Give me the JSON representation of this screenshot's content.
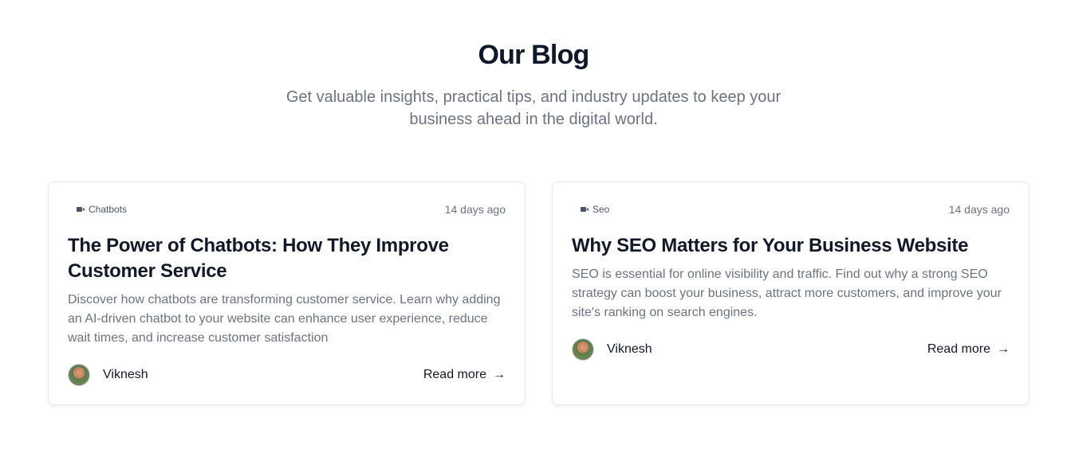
{
  "section": {
    "heading": "Our Blog",
    "subtitle": "Get valuable insights, practical tips, and industry updates to keep your business ahead in the digital world."
  },
  "posts": [
    {
      "category": "Chatbots",
      "category_icon": "video-icon",
      "date": "14 days ago",
      "title": "The Power of Chatbots: How They Improve Customer Service",
      "description": "Discover how chatbots are transforming customer service. Learn why adding an AI-driven chatbot to your website can enhance user experience, reduce wait times, and increase customer satisfaction",
      "author": "Viknesh",
      "read_more": "Read more",
      "read_more_icon": "arrow-right-icon"
    },
    {
      "category": "Seo",
      "category_icon": "video-icon",
      "date": "14 days ago",
      "title": "Why SEO Matters for Your Business Website",
      "description": "SEO is essential for online visibility and traffic. Find out why a strong SEO strategy can boost your business, attract more customers, and improve your site's ranking on search engines.",
      "author": "Viknesh",
      "read_more": "Read more",
      "read_more_icon": "arrow-right-icon"
    }
  ]
}
